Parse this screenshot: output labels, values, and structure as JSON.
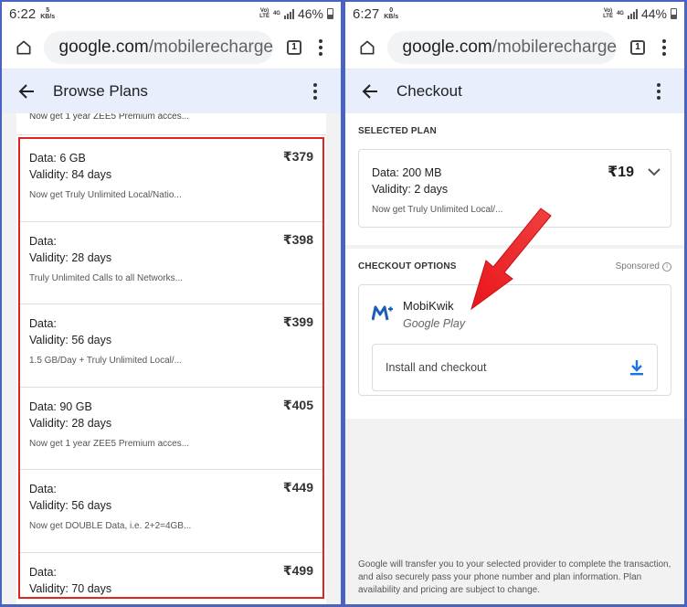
{
  "left": {
    "status": {
      "time": "6:22",
      "speed_value": "5",
      "speed_unit": "KB/s",
      "volte": "Vo)",
      "lte": "LTE",
      "net": "4G",
      "battery": "46%"
    },
    "browser": {
      "domain": "google.com",
      "path": "/mobilerecharge",
      "tab_count": "1"
    },
    "appbar": {
      "title": "Browse Plans"
    },
    "teaser": "Now get 1 year ZEE5 Premium acces...",
    "plans": [
      {
        "data": "Data: 6 GB",
        "validity": "Validity: 84 days",
        "price": "₹379",
        "desc": "Now get Truly Unlimited Local/Natio..."
      },
      {
        "data": "Data:",
        "validity": "Validity: 28 days",
        "price": "₹398",
        "desc": "Truly Unlimited Calls to all Networks..."
      },
      {
        "data": "Data:",
        "validity": "Validity: 56 days",
        "price": "₹399",
        "desc": "1.5 GB/Day + Truly Unlimited Local/..."
      },
      {
        "data": "Data: 90 GB",
        "validity": "Validity: 28 days",
        "price": "₹405",
        "desc": "Now get 1 year ZEE5 Premium acces..."
      },
      {
        "data": "Data:",
        "validity": "Validity: 56 days",
        "price": "₹449",
        "desc": "Now get DOUBLE Data, i.e. 2+2=4GB..."
      },
      {
        "data": "Data:",
        "validity": "Validity: 70 days",
        "price": "₹499",
        "desc": ""
      }
    ]
  },
  "right": {
    "status": {
      "time": "6:27",
      "speed_value": "0",
      "speed_unit": "KB/s",
      "volte": "Vo)",
      "lte": "LTE",
      "net": "4G",
      "battery": "44%"
    },
    "browser": {
      "domain": "google.com",
      "path": "/mobilerecharge",
      "tab_count": "1"
    },
    "appbar": {
      "title": "Checkout"
    },
    "selected_plan": {
      "label": "SELECTED PLAN",
      "data": "Data: 200 MB",
      "validity": "Validity: 2 days",
      "price": "₹19",
      "desc": "Now get Truly Unlimited Local/..."
    },
    "checkout_options": {
      "label": "CHECKOUT OPTIONS",
      "sponsored": "Sponsored",
      "provider_name": "MobiKwik",
      "provider_store": "Google Play",
      "install_label": "Install and checkout"
    },
    "footer": "Google will transfer you to your selected provider to complete the transaction, and also securely pass your phone number and plan information. Plan availability and pricing are subject to change."
  },
  "colors": {
    "highlight": "#e02424",
    "arrow": "#e8161c",
    "appbar_bg": "#e8eefb",
    "frame": "#4a62c0",
    "download": "#1a73e8"
  }
}
